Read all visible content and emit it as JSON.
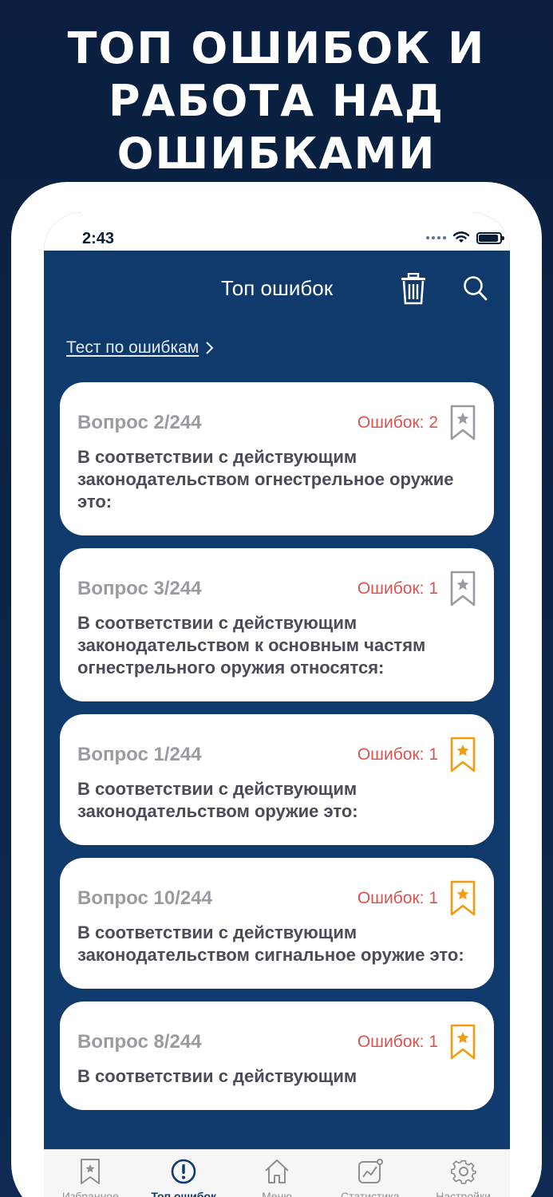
{
  "promo": {
    "line1": "ТОП ОШИБОК И",
    "line2": "РАБОТА НАД",
    "line3": "ОШИБКАМИ"
  },
  "status_bar": {
    "time": "2:43"
  },
  "header": {
    "title": "Топ ошибок"
  },
  "error_test_link": {
    "label": "Тест по ошибкам"
  },
  "questions": [
    {
      "number": "Вопрос 2/244",
      "errors": "Ошибок: 2",
      "text": "В соответствии с действующим законодательством огнестрельное оружие это:",
      "bookmarked": false
    },
    {
      "number": "Вопрос 3/244",
      "errors": "Ошибок: 1",
      "text": "В соответствии с действующим законодательством к основным частям огнестрельного оружия относятся:",
      "bookmarked": false
    },
    {
      "number": "Вопрос 1/244",
      "errors": "Ошибок: 1",
      "text": "В соответствии с действующим законодательством оружие это:",
      "bookmarked": true
    },
    {
      "number": "Вопрос 10/244",
      "errors": "Ошибок: 1",
      "text": "В соответствии с действующим законодательством сигнальное оружие это:",
      "bookmarked": true
    },
    {
      "number": "Вопрос 8/244",
      "errors": "Ошибок: 1",
      "text": "В соответствии с действующим",
      "bookmarked": true
    }
  ],
  "tabs": [
    {
      "label": "Избранное",
      "icon": "bookmark-icon"
    },
    {
      "label": "Топ ошибок",
      "icon": "exclamation-circle-icon",
      "active": true
    },
    {
      "label": "Меню",
      "icon": "home-icon"
    },
    {
      "label": "Статистика",
      "icon": "chart-icon"
    },
    {
      "label": "Настройки",
      "icon": "gear-icon"
    }
  ],
  "colors": {
    "background": "#0a1f3f",
    "screen": "#0f3a6b",
    "error_red": "#d9534f",
    "bookmark_gray": "#9a9aa3",
    "bookmark_orange": "#f39c12"
  }
}
